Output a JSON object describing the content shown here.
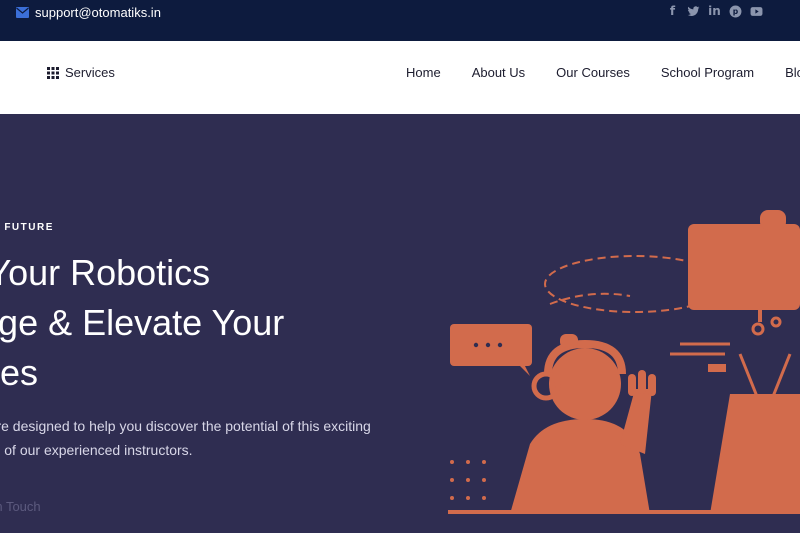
{
  "topbar": {
    "email": "support@otomatiks.in",
    "social": [
      "facebook-icon",
      "twitter-icon",
      "linkedin-icon",
      "pinterest-icon",
      "youtube-icon"
    ]
  },
  "nav": {
    "services_label": "Services",
    "menu": [
      "Home",
      "About Us",
      "Our Courses",
      "School Program",
      "Blo"
    ]
  },
  "hero": {
    "tagline": "'S FUTURE",
    "headline": [
      "e Your Robotics",
      "edge & Elevate Your",
      "tures"
    ],
    "description": [
      "es are designed to help you discover the potential of this exciting",
      "ance of our experienced instructors."
    ],
    "cta": "et in Touch"
  },
  "colors": {
    "topbar": "#0d1b3e",
    "hero_bg": "#2f2d51",
    "accent": "#d26b4c",
    "icon_blue": "#3b6fd8"
  }
}
